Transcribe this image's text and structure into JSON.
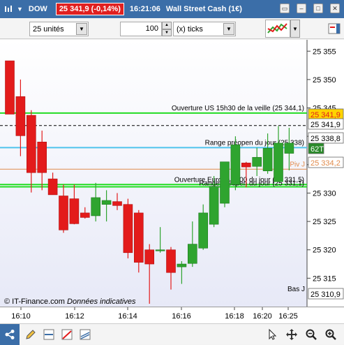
{
  "titlebar": {
    "symbol": "DOW",
    "price_badge": "25 341,9 (-0,14%)",
    "time": "16:21:06",
    "instrument": "Wall Street Cash (1€)"
  },
  "toolbar": {
    "units_value": "25 unités",
    "count_value": "100",
    "ticks_value": "(x) ticks"
  },
  "source": {
    "provider": "© IT-Finance.com",
    "note": "Données indicatives"
  },
  "colors": {
    "up": "#2fa42f",
    "down": "#e31b1b",
    "green_line": "#22dd22",
    "blue_line": "#4fc3ec",
    "orange_line": "#e08a4a",
    "dashed": "#000000"
  },
  "chart_data": {
    "type": "candlestick",
    "ylim": [
      25310.0,
      25357.0
    ],
    "yticks": [
      25355,
      25350,
      25345,
      25340,
      25335,
      25330,
      25325,
      25320,
      25315
    ],
    "xticks": [
      "16:10",
      "16:12",
      "16:14",
      "16:16",
      "16:18",
      "16:20",
      "16:25"
    ],
    "candles": [
      {
        "o": 25353.3,
        "h": 25353.3,
        "l": 25343.9,
        "c": 25343.9
      },
      {
        "o": 25347.0,
        "h": 25350.0,
        "l": 25336.5,
        "c": 25340.1
      },
      {
        "o": 25343.7,
        "h": 25344.6,
        "l": 25330.1,
        "c": 25333.6
      },
      {
        "o": 25339.0,
        "h": 25341.0,
        "l": 25330.5,
        "c": 25333.6
      },
      {
        "o": 25332.5,
        "h": 25333.6,
        "l": 25329.7,
        "c": 25329.7
      },
      {
        "o": 25329.5,
        "h": 25331.5,
        "l": 25323.0,
        "c": 25323.5
      },
      {
        "o": 25329.0,
        "h": 25331.5,
        "l": 25324.5,
        "c": 25324.6
      },
      {
        "o": 25326.5,
        "h": 25327.5,
        "l": 25325.5,
        "c": 25325.7
      },
      {
        "o": 25326.0,
        "h": 25331.8,
        "l": 25325.0,
        "c": 25329.2
      },
      {
        "o": 25328.0,
        "h": 25330.5,
        "l": 25325.0,
        "c": 25328.7
      },
      {
        "o": 25328.5,
        "h": 25330.0,
        "l": 25327.0,
        "c": 25327.8
      },
      {
        "o": 25328.0,
        "h": 25329.0,
        "l": 25318.5,
        "c": 25319.5
      },
      {
        "o": 25326.5,
        "h": 25327.0,
        "l": 25316.0,
        "c": 25317.8
      },
      {
        "o": 25320.0,
        "h": 25321.0,
        "l": 25310.5,
        "c": 25317.5
      },
      {
        "o": 25320.0,
        "h": 25324.0,
        "l": 25319.5,
        "c": 25320.0
      },
      {
        "o": 25320.0,
        "h": 25320.5,
        "l": 25313.0,
        "c": 25316.0
      },
      {
        "o": 25317.0,
        "h": 25318.0,
        "l": 25314.0,
        "c": 25317.5
      },
      {
        "o": 25317.6,
        "h": 25325.0,
        "l": 25317.0,
        "c": 25321.0
      },
      {
        "o": 25320.3,
        "h": 25328.0,
        "l": 25320.0,
        "c": 25326.5
      },
      {
        "o": 25324.5,
        "h": 25333.0,
        "l": 25324.0,
        "c": 25331.2
      },
      {
        "o": 25328.2,
        "h": 25334.5,
        "l": 25327.5,
        "c": 25335.5
      },
      {
        "o": 25331.5,
        "h": 25340.0,
        "l": 25330.5,
        "c": 25338.5
      },
      {
        "o": 25335.3,
        "h": 25335.5,
        "l": 25331.0,
        "c": 25334.6
      },
      {
        "o": 25334.7,
        "h": 25338.0,
        "l": 25333.0,
        "c": 25336.3
      },
      {
        "o": 25333.9,
        "h": 25340.5,
        "l": 25333.4,
        "c": 25337.9
      },
      {
        "o": 25332.0,
        "h": 25341.8,
        "l": 25332.0,
        "c": 25338.8
      },
      {
        "o": 25337.0,
        "h": 25341.5,
        "l": 25334.0,
        "c": 25338.8
      }
    ],
    "levels": [
      {
        "name": "Ouverture US 15h30 de la veille",
        "price": 25344.1,
        "label": "Ouverture US 15h30 de la veille (25 344,1)",
        "color": "green"
      },
      {
        "name": "Range préopen du jour",
        "price": 25338.0,
        "label": "Range préopen du jour (25 338)",
        "color": "blue"
      },
      {
        "name": "Piv J",
        "price": 25334.2,
        "label": "Piv J",
        "color": "orange"
      },
      {
        "name": "Ouverture Europe 9h00 du jour",
        "price": 25331.5,
        "label": "Ouverture Europe 9h00 du jour (25 331,5)",
        "color": "green"
      },
      {
        "name": "Range préopen du jour",
        "price": 25331.1,
        "label": "Range préopen du jour (25 331,1)",
        "color": "green"
      }
    ],
    "dashed_price": 25341.9,
    "price_tags": [
      {
        "text": "25 341,9",
        "kind": "last"
      },
      {
        "text": "25 341,9",
        "kind": "plain"
      },
      {
        "text": "25 338,8",
        "kind": "plain"
      },
      {
        "text": "62T",
        "kind": "ticks"
      },
      {
        "text": "25 334,2",
        "kind": "piv"
      },
      {
        "text": "25 310,9",
        "kind": "plain"
      }
    ],
    "bas_label": "Bas J"
  }
}
